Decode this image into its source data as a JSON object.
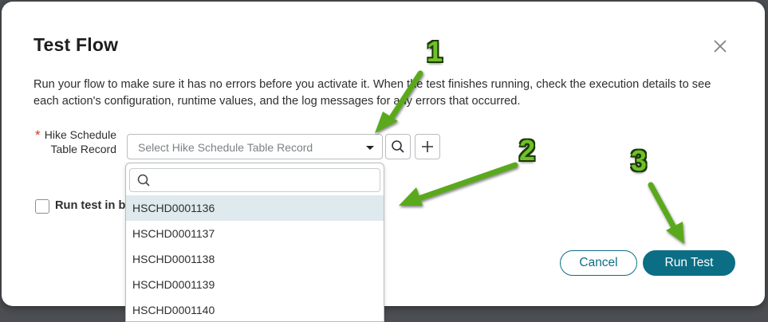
{
  "dialog": {
    "title": "Test Flow",
    "description": "Run your flow to make sure it has no errors before you activate it. When the test finishes running, check the execution details to see each action's configuration, runtime values, and the log messages for any errors that occurred.",
    "required_mark": "*",
    "field_label": "Hike Schedule Table Record",
    "field_placeholder": "Select Hike Schedule Table Record",
    "background_checkbox_label": "Run test in background",
    "cancel_label": "Cancel",
    "run_label": "Run Test"
  },
  "dropdown": {
    "search_value": "",
    "items": [
      "HSCHD0001136",
      "HSCHD0001137",
      "HSCHD0001138",
      "HSCHD0001139",
      "HSCHD0001140"
    ],
    "selected_index": 0
  },
  "annotations": [
    "1",
    "2",
    "3"
  ],
  "colors": {
    "accent": "#0b6e84",
    "required": "#c8372d",
    "highlight": "#dfeaee",
    "arrow": "#6fc12a"
  },
  "icons": [
    "close-icon",
    "caret-down-icon",
    "search-icon",
    "plus-icon"
  ]
}
